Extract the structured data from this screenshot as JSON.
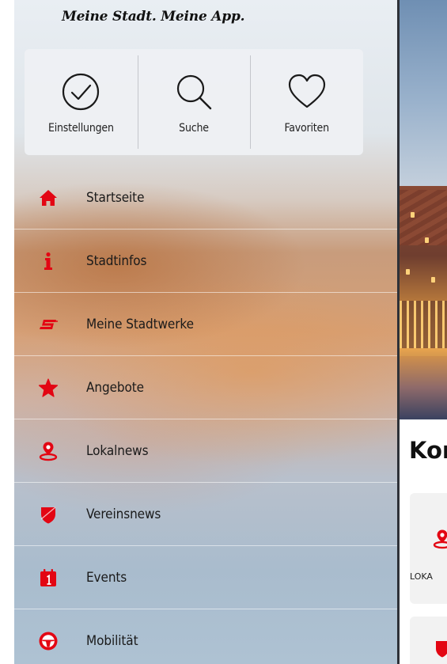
{
  "app": {
    "tagline": "Meine Stadt. Meine App."
  },
  "colors": {
    "accent": "#e30613",
    "panel": "#eef0f3"
  },
  "quick_actions": [
    {
      "label": "Einstellungen",
      "icon": "check-circle-icon"
    },
    {
      "label": "Suche",
      "icon": "search-icon"
    },
    {
      "label": "Favoriten",
      "icon": "heart-icon"
    }
  ],
  "menu": [
    {
      "label": "Startseite",
      "icon": "home-icon"
    },
    {
      "label": "Stadtinfos",
      "icon": "info-icon"
    },
    {
      "label": "Meine Stadtwerke",
      "icon": "stadtwerke-logo-icon"
    },
    {
      "label": "Angebote",
      "icon": "star-icon"
    },
    {
      "label": "Lokalnews",
      "icon": "location-pin-icon"
    },
    {
      "label": "Vereinsnews",
      "icon": "shield-icon"
    },
    {
      "label": "Events",
      "icon": "calendar-icon"
    },
    {
      "label": "Mobilität",
      "icon": "steering-wheel-icon"
    }
  ],
  "background_page": {
    "title_fragment": "Kor",
    "card_label_fragment": "LOKA"
  }
}
